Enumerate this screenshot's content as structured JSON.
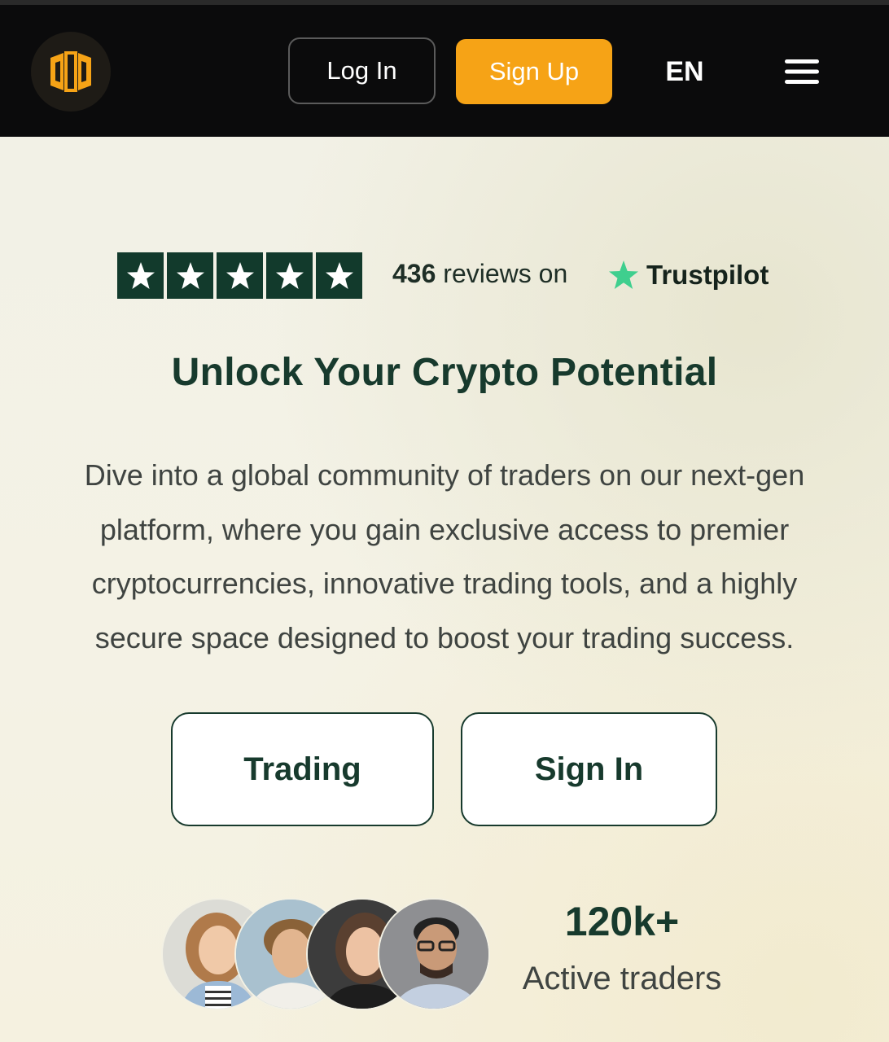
{
  "header": {
    "logo_icon": "exchange-logo-icon",
    "login_label": "Log In",
    "signup_label": "Sign Up",
    "language": "EN",
    "menu_icon": "hamburger-menu-icon"
  },
  "trustpilot": {
    "rating_stars": 5,
    "review_count": "436",
    "reviews_suffix": "reviews on",
    "brand": "Trustpilot",
    "star_color": "#123a2c",
    "brand_star_color": "#3fcf8e"
  },
  "hero": {
    "title": "Unlock Your Crypto Potential",
    "description_lines": [
      "Dive into a global community of traders on our next-gen",
      "platform, where you gain exclusive access to premier",
      "cryptocurrencies, innovative trading tools, and a highly",
      "secure space designed to boost your trading success."
    ],
    "primary_cta": "Trading",
    "secondary_cta": "Sign In"
  },
  "stats": {
    "value": "120k+",
    "label": "Active traders"
  },
  "colors": {
    "header_bg": "#0b0b0c",
    "accent": "#f6a316",
    "brand_green": "#173a2d",
    "page_bg": "#f3f1e4"
  }
}
